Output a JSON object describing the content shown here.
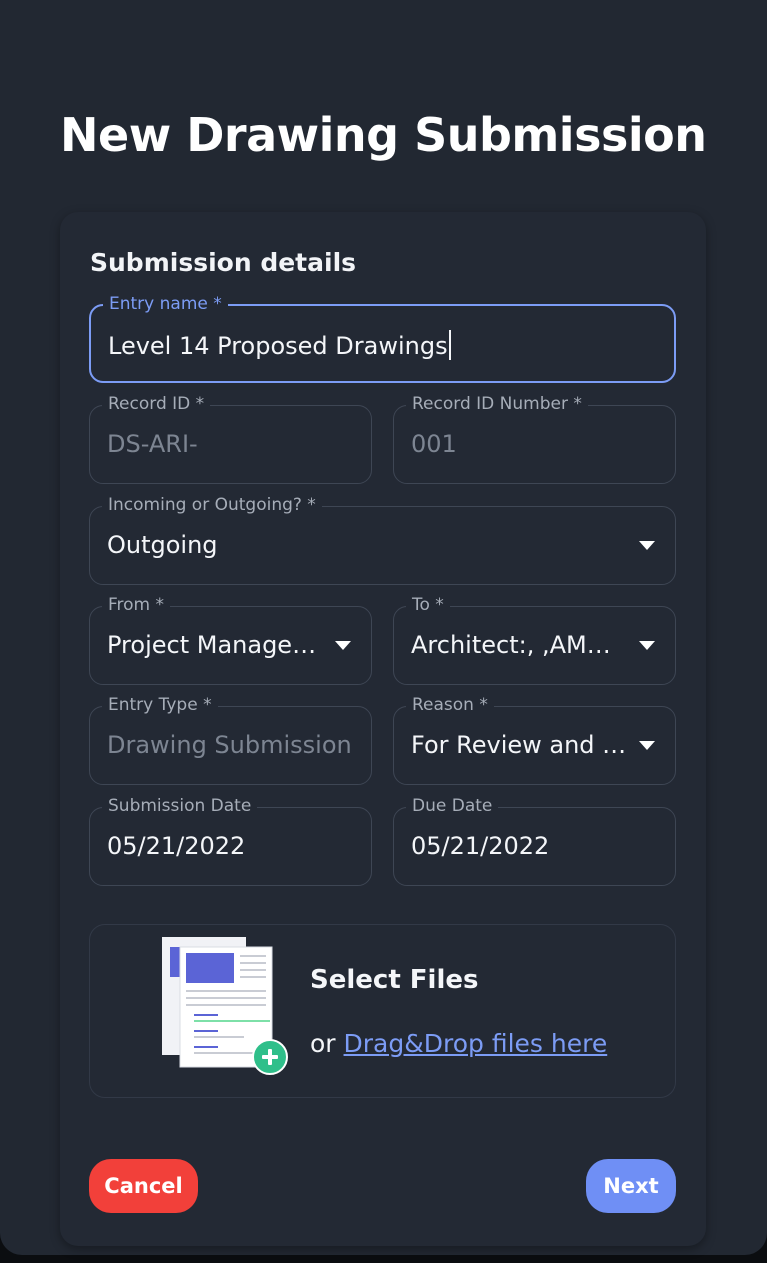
{
  "modal": {
    "title": "New Drawing Submission"
  },
  "form": {
    "section_title": "Submission details",
    "entry_name": {
      "label": "Entry name *",
      "value": "Level 14 Proposed Drawings"
    },
    "record_id": {
      "label": "Record ID *",
      "placeholder": "DS-ARI-"
    },
    "record_id_number": {
      "label": "Record ID Number *",
      "placeholder": "001"
    },
    "direction": {
      "label": "Incoming or Outgoing? *",
      "value": "Outgoing"
    },
    "from": {
      "label": "From *",
      "value": "Project Manager:,..."
    },
    "to": {
      "label": "To *",
      "value": "Architect:, ,AMAN..."
    },
    "entry_type": {
      "label": "Entry Type *",
      "value": "Drawing Submission"
    },
    "reason": {
      "label": "Reason *",
      "value": "For Review and C..."
    },
    "submission_date": {
      "label": "Submission Date",
      "value": "05/21/2022"
    },
    "due_date": {
      "label": "Due Date",
      "value": "05/21/2022"
    }
  },
  "dropzone": {
    "title": "Select Files",
    "or_text": "or",
    "link_text": "Drag&Drop files here",
    "icon": "files-add-icon"
  },
  "actions": {
    "cancel_label": "Cancel",
    "next_label": "Next"
  },
  "colors": {
    "accent": "#7c9cf5",
    "cancel": "#f2403a",
    "next": "#6f8ff5",
    "add_badge": "#2fbf8a"
  }
}
